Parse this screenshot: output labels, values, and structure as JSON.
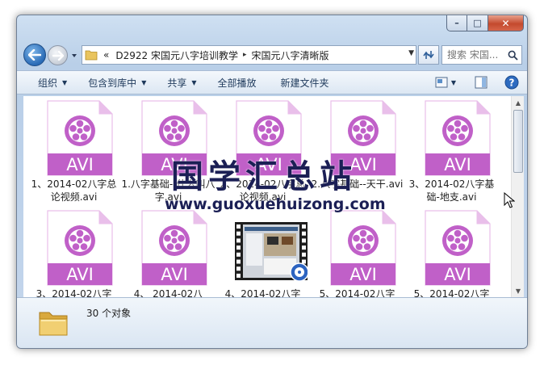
{
  "window": {
    "caption": {
      "minimize": "–",
      "maximize": "□",
      "close": "✕"
    }
  },
  "nav": {
    "breadcrumb_prefix": "«",
    "path": [
      "D2922 宋国元八字培训教学",
      "宋国元八字清晰版"
    ],
    "path_separator": "▸",
    "search_placeholder": "搜索 宋国..."
  },
  "toolbar": {
    "organize": "组织",
    "include_in_library": "包含到库中",
    "share": "共享",
    "play_all": "全部播放",
    "new_folder": "新建文件夹"
  },
  "files": [
    {
      "label": "1、2014-02八字总论视频.avi",
      "type": "AVI",
      "icon": "avi-file-icon"
    },
    {
      "label": "1.八字基础--什么叫八字.avi",
      "type": "AVI",
      "icon": "avi-file-icon"
    },
    {
      "label": "2、2014-02八字总论视频.avi",
      "type": "AVI",
      "icon": "avi-file-icon"
    },
    {
      "label": "2.八字基础--天干.avi",
      "type": "AVI",
      "icon": "avi-file-icon"
    },
    {
      "label": "3、2014-02八字基础-地支.avi",
      "type": "AVI",
      "icon": "avi-file-icon"
    },
    {
      "label": "3、2014-02八字",
      "type": "AVI",
      "icon": "avi-file-icon"
    },
    {
      "label": "4、 2014-02八",
      "type": "AVI",
      "icon": "avi-file-icon"
    },
    {
      "label": "4、2014-02八字",
      "type": "VIDEO",
      "icon": "video-thumbnail-icon"
    },
    {
      "label": "5、2014-02八字",
      "type": "AVI",
      "icon": "avi-file-icon"
    },
    {
      "label": "5、2014-02八字",
      "type": "AVI",
      "icon": "avi-file-icon"
    }
  ],
  "status": {
    "count": "30 个对象"
  },
  "watermark": {
    "title": "国学汇总站",
    "url": "www.guoxuehuizong.com"
  },
  "colors": {
    "avi_purple": "#c060c8",
    "avi_light": "#e9bfea",
    "accent": "#1e395b"
  }
}
